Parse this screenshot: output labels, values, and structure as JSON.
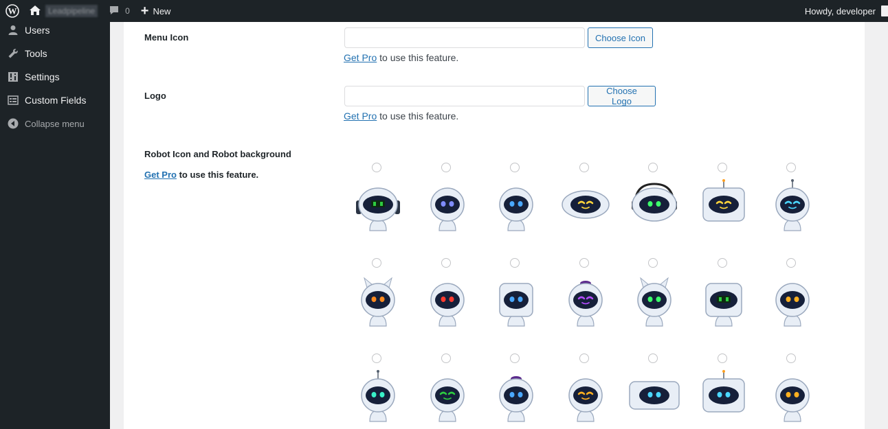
{
  "admin_bar": {
    "site_name": "Leadpipeline",
    "comments_count": "0",
    "new_label": "New",
    "howdy": "Howdy, developer"
  },
  "sidebar": {
    "items": [
      {
        "label": "Users",
        "icon": "users-icon"
      },
      {
        "label": "Tools",
        "icon": "wrench-icon"
      },
      {
        "label": "Settings",
        "icon": "settings-icon"
      },
      {
        "label": "Custom Fields",
        "icon": "custom-fields-icon"
      }
    ],
    "collapse_label": "Collapse menu"
  },
  "settings": {
    "menu_icon": {
      "label": "Menu Icon",
      "value": "",
      "button": "Choose Icon",
      "pro_link": "Get Pro",
      "pro_text": " to use this feature."
    },
    "logo": {
      "label": "Logo",
      "value": "",
      "button": "Choose Logo",
      "pro_link": "Get Pro",
      "pro_text": " to use this feature."
    },
    "robot": {
      "label": "Robot Icon and Robot background",
      "pro_link": "Get Pro",
      "pro_text": " to use this feature."
    }
  },
  "colors": {
    "admin_bar": "#1d2327",
    "accent": "#2271b1",
    "content_bg": "#ffffff",
    "page_bg": "#f0f0f1"
  },
  "robots": [
    {
      "name": "robot-1",
      "shape": "ring",
      "eye": "#2ecc40",
      "eye_style": "screen"
    },
    {
      "name": "robot-2",
      "shape": "capsule",
      "eye": "#7f8cff",
      "eye_style": "dots"
    },
    {
      "name": "robot-3",
      "shape": "small",
      "eye": "#4aa8ff",
      "eye_style": "dots"
    },
    {
      "name": "robot-4",
      "shape": "oval",
      "eye": "#ffd53b",
      "eye_style": "smile"
    },
    {
      "name": "robot-5",
      "shape": "headset",
      "eye": "#3cff6b",
      "eye_style": "dots"
    },
    {
      "name": "robot-6",
      "shape": "tv",
      "eye": "#ffd53b",
      "eye_style": "smile"
    },
    {
      "name": "robot-7",
      "shape": "antenna",
      "eye": "#4bd7ff",
      "eye_style": "smile"
    },
    {
      "name": "robot-8",
      "shape": "horned",
      "eye": "#ff8a1f",
      "eye_style": "dots"
    },
    {
      "name": "robot-9",
      "shape": "bust",
      "eye": "#ff3b2f",
      "eye_style": "dots"
    },
    {
      "name": "robot-10",
      "shape": "visor",
      "eye": "#4aa8ff",
      "eye_style": "dots"
    },
    {
      "name": "robot-11",
      "shape": "helmet",
      "eye": "#b44bff",
      "eye_style": "smile"
    },
    {
      "name": "robot-12",
      "shape": "cat",
      "eye": "#3cff6b",
      "eye_style": "dots"
    },
    {
      "name": "robot-13",
      "shape": "screen",
      "eye": "#2ecc40",
      "eye_style": "screen"
    },
    {
      "name": "robot-14",
      "shape": "round",
      "eye": "#ffb020",
      "eye_style": "dots"
    },
    {
      "name": "robot-15",
      "shape": "antenna",
      "eye": "#39f0c8",
      "eye_style": "dots"
    },
    {
      "name": "robot-16",
      "shape": "round",
      "eye": "#2ecc40",
      "eye_style": "smile"
    },
    {
      "name": "robot-17",
      "shape": "helmet",
      "eye": "#4aa8ff",
      "eye_style": "dots"
    },
    {
      "name": "robot-18",
      "shape": "astro",
      "eye": "#ffb020",
      "eye_style": "smile"
    },
    {
      "name": "robot-19",
      "shape": "wide",
      "eye": "#4bd7ff",
      "eye_style": "dots"
    },
    {
      "name": "robot-20",
      "shape": "tv",
      "eye": "#4bd7ff",
      "eye_style": "dots"
    },
    {
      "name": "robot-21",
      "shape": "dome",
      "eye": "#ffb020",
      "eye_style": "dots"
    }
  ]
}
